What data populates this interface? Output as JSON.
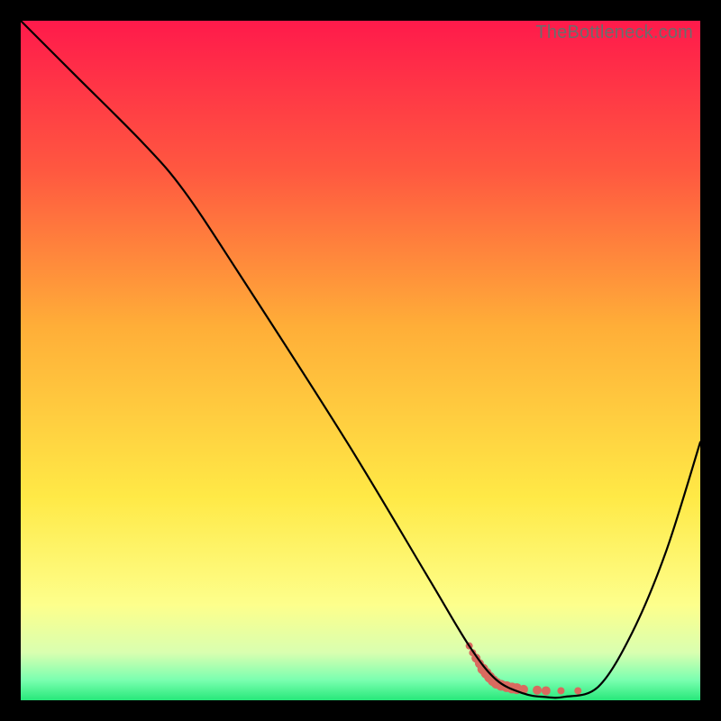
{
  "watermark": "TheBottleneck.com",
  "chart_data": {
    "type": "line",
    "title": "",
    "xlabel": "",
    "ylabel": "",
    "xlim": [
      0,
      100
    ],
    "ylim": [
      0,
      100
    ],
    "gradient_stops": [
      {
        "offset": 0,
        "color": "#ff1a4b"
      },
      {
        "offset": 22,
        "color": "#ff5840"
      },
      {
        "offset": 45,
        "color": "#ffae38"
      },
      {
        "offset": 70,
        "color": "#ffe946"
      },
      {
        "offset": 86,
        "color": "#fdff8c"
      },
      {
        "offset": 93,
        "color": "#d9ffb0"
      },
      {
        "offset": 97,
        "color": "#7bffb0"
      },
      {
        "offset": 100,
        "color": "#27e87a"
      }
    ],
    "series": [
      {
        "name": "bottleneck-curve",
        "x": [
          0,
          8,
          18,
          24,
          32,
          48,
          60,
          66,
          70,
          74,
          77,
          80,
          85,
          90,
          95,
          100
        ],
        "y": [
          100,
          92,
          82,
          75,
          63,
          38,
          18,
          8,
          3,
          1,
          0.5,
          0.5,
          2,
          10,
          22,
          38
        ]
      }
    ],
    "markers": {
      "name": "highlight-range",
      "color": "#d96a5f",
      "points": [
        {
          "x": 66,
          "y": 8.0,
          "r": 4
        },
        {
          "x": 66.5,
          "y": 7.0,
          "r": 4
        },
        {
          "x": 67,
          "y": 6.2,
          "r": 5
        },
        {
          "x": 67.5,
          "y": 5.4,
          "r": 5
        },
        {
          "x": 68,
          "y": 4.6,
          "r": 6
        },
        {
          "x": 68.5,
          "y": 4.0,
          "r": 6
        },
        {
          "x": 69,
          "y": 3.4,
          "r": 6
        },
        {
          "x": 69.5,
          "y": 2.9,
          "r": 6
        },
        {
          "x": 70,
          "y": 2.5,
          "r": 6
        },
        {
          "x": 70.7,
          "y": 2.2,
          "r": 6
        },
        {
          "x": 71.5,
          "y": 2.0,
          "r": 6
        },
        {
          "x": 72.3,
          "y": 1.8,
          "r": 6
        },
        {
          "x": 73,
          "y": 1.7,
          "r": 6
        },
        {
          "x": 74,
          "y": 1.6,
          "r": 5
        },
        {
          "x": 76,
          "y": 1.5,
          "r": 5
        },
        {
          "x": 77.3,
          "y": 1.4,
          "r": 5
        },
        {
          "x": 79.5,
          "y": 1.4,
          "r": 4
        },
        {
          "x": 82,
          "y": 1.4,
          "r": 4
        }
      ]
    }
  }
}
